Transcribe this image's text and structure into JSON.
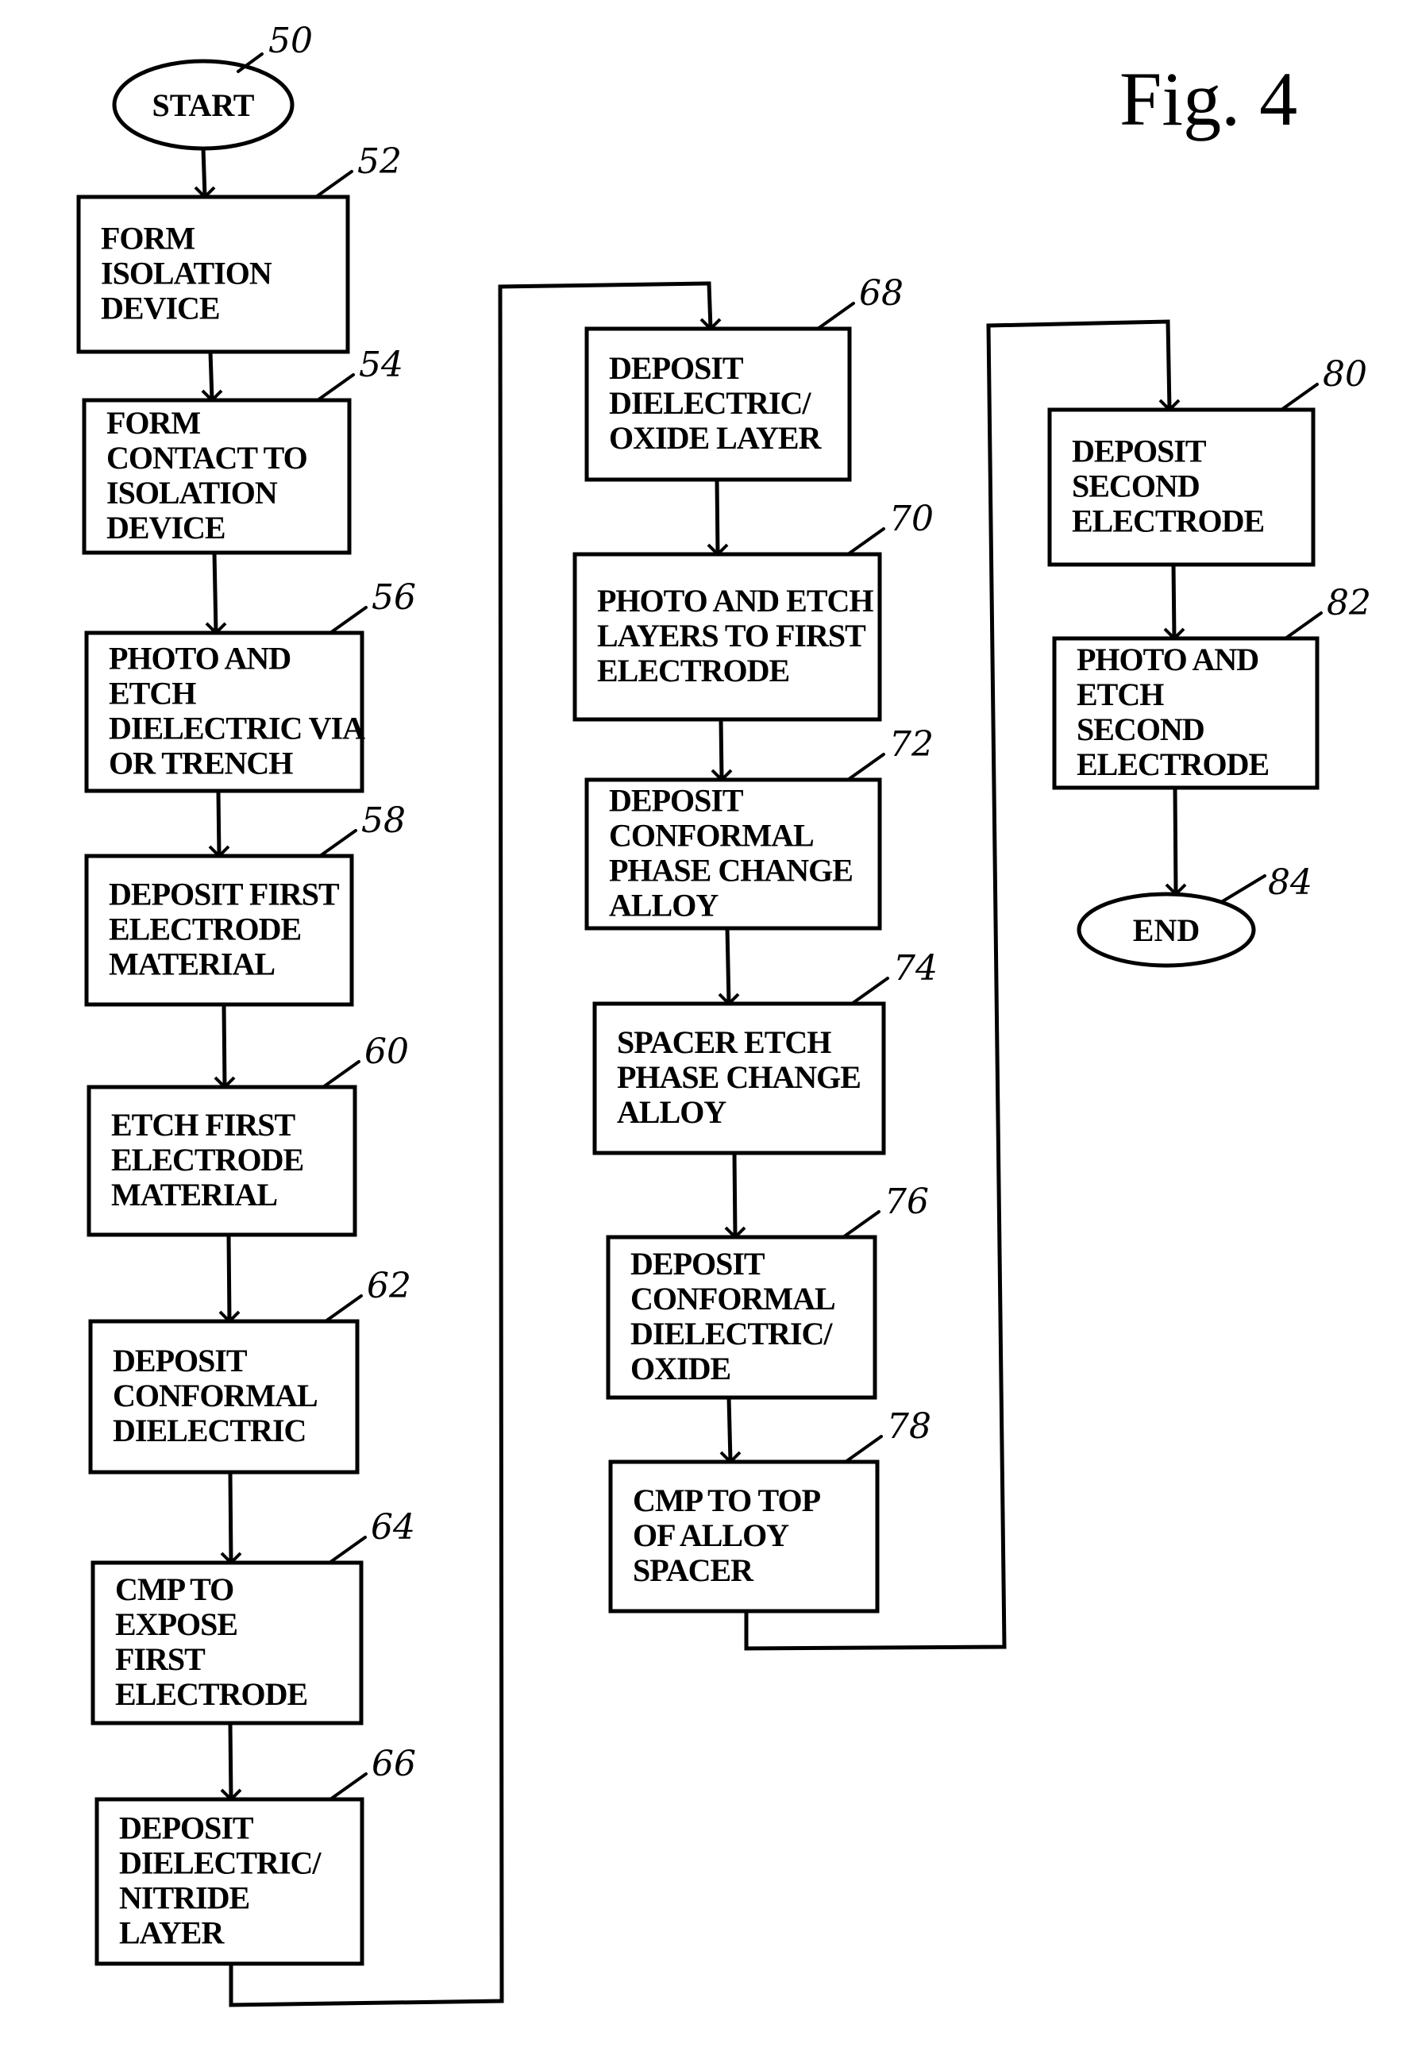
{
  "figure": {
    "title": "Fig. 4",
    "colors": {
      "ink": "#000000",
      "paper": "#ffffff"
    }
  },
  "start": {
    "ref": "50",
    "label": "START"
  },
  "end": {
    "ref": "84",
    "label": "END"
  },
  "steps": [
    {
      "ref": "52",
      "lines": [
        "FORM",
        "ISOLATION",
        "DEVICE"
      ]
    },
    {
      "ref": "54",
      "lines": [
        "FORM",
        "CONTACT TO",
        "ISOLATION",
        "DEVICE"
      ]
    },
    {
      "ref": "56",
      "lines": [
        "PHOTO AND",
        "ETCH",
        "DIELECTRIC VIA",
        "OR TRENCH"
      ]
    },
    {
      "ref": "58",
      "lines": [
        "DEPOSIT FIRST",
        "ELECTRODE",
        "MATERIAL"
      ]
    },
    {
      "ref": "60",
      "lines": [
        "ETCH FIRST",
        "ELECTRODE",
        "MATERIAL"
      ]
    },
    {
      "ref": "62",
      "lines": [
        "DEPOSIT",
        "CONFORMAL",
        "DIELECTRIC"
      ]
    },
    {
      "ref": "64",
      "lines": [
        "CMP TO",
        "EXPOSE",
        "FIRST",
        "ELECTRODE"
      ]
    },
    {
      "ref": "66",
      "lines": [
        "DEPOSIT",
        "DIELECTRIC/",
        "NITRIDE",
        "LAYER"
      ]
    },
    {
      "ref": "68",
      "lines": [
        "DEPOSIT",
        "DIELECTRIC/",
        "OXIDE LAYER"
      ]
    },
    {
      "ref": "70",
      "lines": [
        "PHOTO AND ETCH",
        "LAYERS TO FIRST",
        "ELECTRODE"
      ]
    },
    {
      "ref": "72",
      "lines": [
        "DEPOSIT",
        "CONFORMAL",
        "PHASE CHANGE",
        "ALLOY"
      ]
    },
    {
      "ref": "74",
      "lines": [
        "SPACER ETCH",
        "PHASE CHANGE",
        "ALLOY"
      ]
    },
    {
      "ref": "76",
      "lines": [
        "DEPOSIT",
        "CONFORMAL",
        "DIELECTRIC/",
        "OXIDE"
      ]
    },
    {
      "ref": "78",
      "lines": [
        "CMP TO TOP",
        "OF ALLOY",
        "SPACER"
      ]
    },
    {
      "ref": "80",
      "lines": [
        "DEPOSIT",
        "SECOND",
        "ELECTRODE"
      ]
    },
    {
      "ref": "82",
      "lines": [
        "PHOTO AND",
        "ETCH",
        "SECOND",
        "ELECTRODE"
      ]
    }
  ]
}
